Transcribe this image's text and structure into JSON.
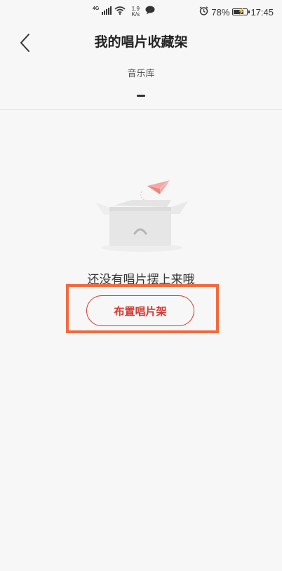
{
  "status_bar": {
    "network_type": "4G",
    "speed_value": "1.9",
    "speed_unit": "K/s",
    "battery_percent": "78%",
    "battery_level": 0.78,
    "time": "17:45",
    "icons": [
      "signal-icon",
      "wifi-icon",
      "chat-bubble-icon",
      "alarm-icon",
      "battery-icon"
    ]
  },
  "header": {
    "title": "我的唱片收藏架"
  },
  "tabs": [
    {
      "label": "音乐库",
      "active": true
    }
  ],
  "empty_state": {
    "message": "还没有唱片摆上来哦",
    "button_label": "布置唱片架"
  },
  "colors": {
    "accent": "#d33a31",
    "highlight_box": "#f06b3f",
    "background": "#f7f7f7",
    "paper_plane": "#f4a9a3"
  }
}
